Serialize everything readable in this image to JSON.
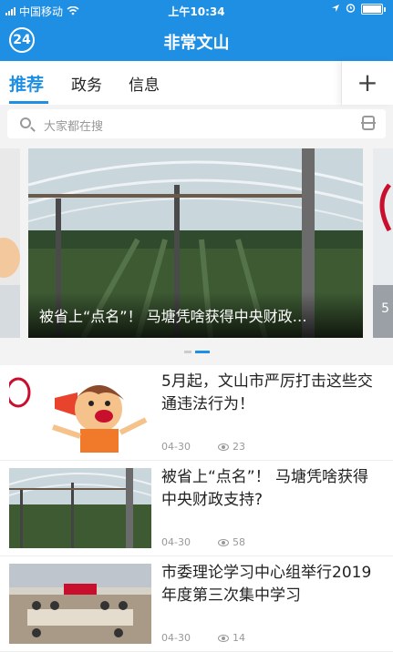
{
  "status": {
    "carrier": "中国移动",
    "time": "上午10:34"
  },
  "header": {
    "logo": "24",
    "title": "非常文山"
  },
  "tabs": [
    {
      "label": "推荐"
    },
    {
      "label": "政务"
    },
    {
      "label": "信息"
    }
  ],
  "search": {
    "placeholder": "大家都在搜"
  },
  "carousel": {
    "caption": "被省上“点名”！ 马塘凭啥获得中央财政…",
    "side_right_number": "5"
  },
  "news": [
    {
      "title": "5月起，文山市严厉打击这些交通违法行为！",
      "date": "04-30",
      "views": "23"
    },
    {
      "title": "被省上“点名”！ 马塘凭啥获得中央财政支持?",
      "date": "04-30",
      "views": "58"
    },
    {
      "title": "市委理论学习中心组举行2019年度第三次集中学习",
      "date": "04-30",
      "views": "14"
    }
  ],
  "colors": {
    "brand": "#1f8fe3"
  }
}
